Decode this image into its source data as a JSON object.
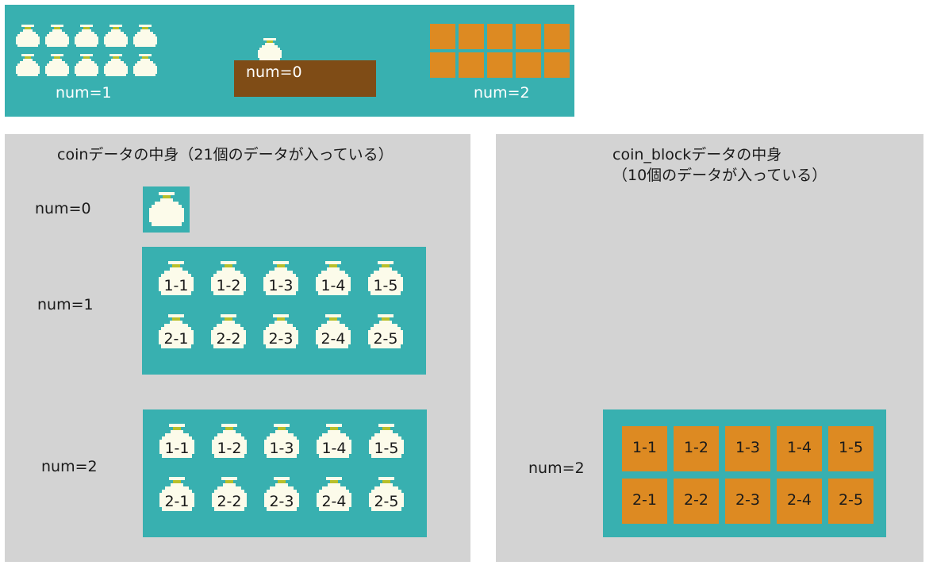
{
  "top_scene": {
    "left_label": "num=1",
    "center_label": "num=0",
    "right_label": "num=2"
  },
  "coin_panel": {
    "title": "coinデータの中身（21個のデータが入っている）",
    "groups": [
      {
        "label": "num=0"
      },
      {
        "label": "num=1",
        "coins": [
          "1-1",
          "1-2",
          "1-3",
          "1-4",
          "1-5",
          "2-1",
          "2-2",
          "2-3",
          "2-4",
          "2-5"
        ]
      },
      {
        "label": "num=2",
        "coins": [
          "1-1",
          "1-2",
          "1-3",
          "1-4",
          "1-5",
          "2-1",
          "2-2",
          "2-3",
          "2-4",
          "2-5"
        ]
      }
    ]
  },
  "block_panel": {
    "title_line1": "coin_blockデータの中身",
    "title_line2": "（10個のデータが入っている）",
    "group": {
      "label": "num=2",
      "blocks": [
        "1-1",
        "1-2",
        "1-3",
        "1-4",
        "1-5",
        "2-1",
        "2-2",
        "2-3",
        "2-4",
        "2-5"
      ]
    }
  },
  "colors": {
    "teal": "#38b0b0",
    "gray": "#d3d3d3",
    "brown": "#7f4c16",
    "orange": "#dd8a22",
    "coin": "#fcfbea",
    "stem": "#b8bf2a"
  }
}
